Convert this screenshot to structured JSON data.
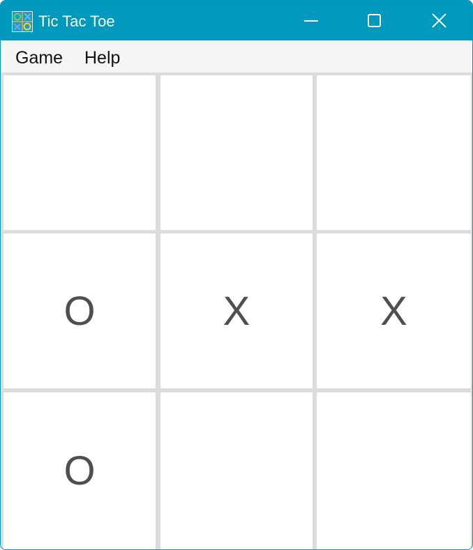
{
  "window": {
    "title": "Tic Tac Toe",
    "accent_color": "#0098bd",
    "icon": "tic-tac-toe-app-icon"
  },
  "controls": {
    "minimize_icon": "minimize-icon",
    "maximize_icon": "maximize-icon",
    "close_icon": "close-icon"
  },
  "menu": {
    "items": [
      "Game",
      "Help"
    ]
  },
  "board": {
    "cells": [
      [
        "",
        "",
        ""
      ],
      [
        "O",
        "X",
        "X"
      ],
      [
        "O",
        "",
        ""
      ]
    ]
  }
}
